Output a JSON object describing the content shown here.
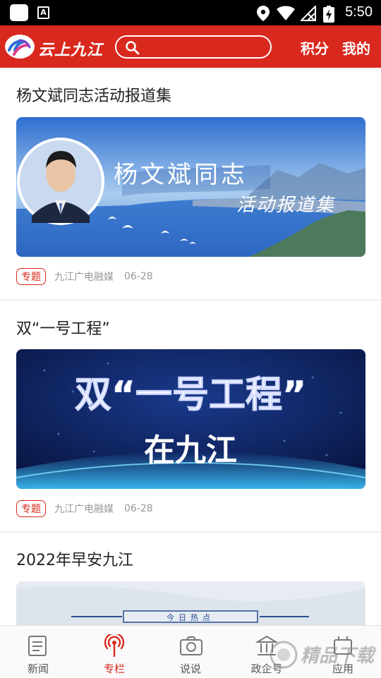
{
  "status_bar": {
    "time": "5:50",
    "a_icon": "A"
  },
  "header": {
    "logo_text": "云上九江",
    "search_placeholder": "",
    "points_label": "积分",
    "mine_label": "我的"
  },
  "feed": [
    {
      "title": "杨文斌同志活动报道集",
      "image_text_line1": "杨文斌同志",
      "image_text_line2": "活动报道集",
      "tag": "专题",
      "source": "九江广电融媒",
      "date": "06-28"
    },
    {
      "title": "双“一号工程”",
      "image_text_line1": "双“一号工程”",
      "image_text_line2": "在九江",
      "tag": "专题",
      "source": "九江广电融媒",
      "date": "06-28"
    },
    {
      "title": "2022年早安九江",
      "image_text_line1": "今日热点"
    }
  ],
  "bottom_nav": [
    {
      "label": "新闻",
      "icon": "news-icon",
      "active": false
    },
    {
      "label": "专栏",
      "icon": "broadcast-icon",
      "active": true
    },
    {
      "label": "说说",
      "icon": "camera-icon",
      "active": false
    },
    {
      "label": "政企号",
      "icon": "government-icon",
      "active": false
    },
    {
      "label": "应用",
      "icon": "apps-icon",
      "active": false
    }
  ],
  "colors": {
    "brand": "#d9281d",
    "tag": "#d9281d",
    "meta": "#999999"
  },
  "watermark": {
    "text": "精品下载"
  }
}
